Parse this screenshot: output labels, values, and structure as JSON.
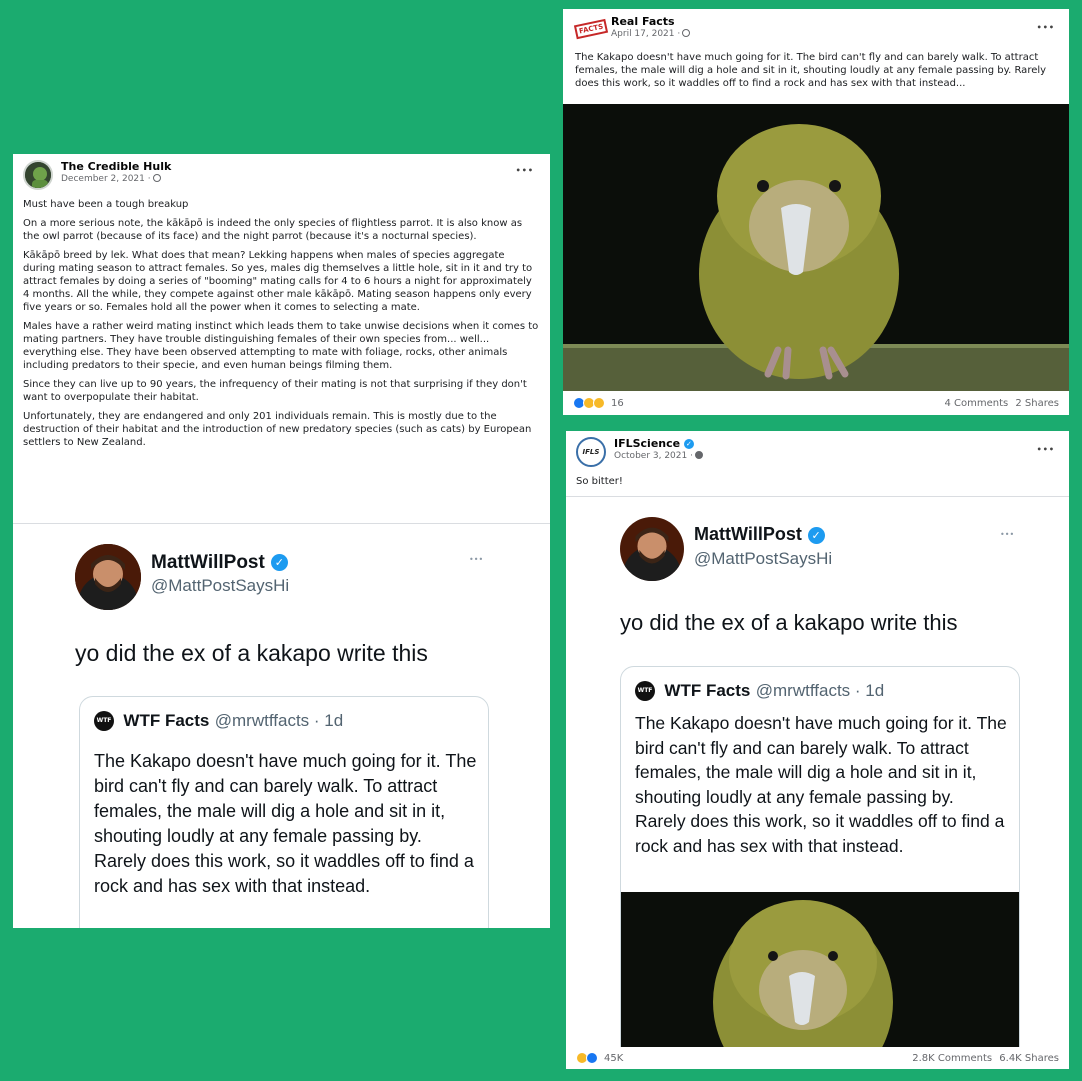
{
  "left_post": {
    "author": "The Credible Hulk",
    "date": "December 2, 2021 ·",
    "caption": "Must have been a tough breakup",
    "paragraphs": [
      "On a more serious note, the kākāpō is indeed the only species of flightless parrot. It is also know as the owl parrot (because of its face) and the night parrot (because it's a nocturnal species).",
      "Kākāpō breed by lek. What does that mean? Lekking happens when males of species aggregate during mating season to attract females. So yes, males dig themselves a little hole, sit in it and try to attract females by doing a series of \"booming\" mating calls for 4 to 6 hours a night for approximately 4 months. All the while, they compete against other male kākāpō. Mating season happens only every five years or so. Females hold all the power when it comes to selecting a mate.",
      "Males have a rather weird mating instinct which leads them to take unwise decisions when it comes to mating partners. They have trouble distinguishing females of their own species from... well... everything else. They have been observed attempting to mate with foliage, rocks, other animals including predators to their specie, and even human beings filming them.",
      "Since they can live up to 90 years, the infrequency of their mating is not that surprising if they don't want to overpopulate their habitat.",
      "Unfortunately, they are endangered and only 201 individuals remain. This is mostly due to the destruction of their habitat and the introduction of new predatory species (such as cats) by European settlers to New Zealand."
    ],
    "tweet": {
      "name": "MattWillPost",
      "handle": "@MattPostSaysHi",
      "text": "yo did the ex of a kakapo write this",
      "quote_name": "WTF Facts",
      "quote_handle": "@mrwtffacts · 1d",
      "quote_text": "The Kakapo doesn't have much going for it. The bird can't fly and can barely walk. To attract females, the male will dig a hole and sit in it, shouting loudly at any female passing by. Rarely does this work, so it waddles off to find a rock and has sex with that instead."
    }
  },
  "top_right_post": {
    "author": "Real Facts",
    "logo_text": "FACTS",
    "date": "April 17, 2021 ·",
    "caption": "The Kakapo doesn't have much going for it. The bird can't fly and can barely walk. To attract females, the male will dig a hole and sit in it, shouting loudly at any female passing by. Rarely does this work, so it waddles off to find a rock and has sex with that instead...",
    "reactions": "16",
    "comments": "4 Comments",
    "shares": "2 Shares"
  },
  "bottom_right_post": {
    "author": "IFLScience",
    "logo_text": "IFLS",
    "date": "October 3, 2021 ·",
    "caption": "So bitter!",
    "tweet": {
      "name": "MattWillPost",
      "handle": "@MattPostSaysHi",
      "text": "yo did the ex of a kakapo write this",
      "quote_name": "WTF Facts",
      "quote_handle": "@mrwtffacts · 1d",
      "quote_text": "The Kakapo doesn't have much going for it. The bird can't fly and can barely walk. To attract females, the male will dig a hole and sit in it, shouting loudly at any female passing by. Rarely does this work, so it waddles off to find a rock and has sex with that instead."
    },
    "reactions": "45K",
    "comments": "2.8K Comments",
    "shares": "6.4K Shares"
  },
  "common": {
    "more_glyph": "•••",
    "verified_glyph": "✓",
    "wtf_logo_text": "WTF"
  },
  "colors": {
    "background": "#1bab6f",
    "like_blue": "#1877f2",
    "haha_yellow": "#f7b928",
    "verified_blue": "#1d9bf0"
  }
}
